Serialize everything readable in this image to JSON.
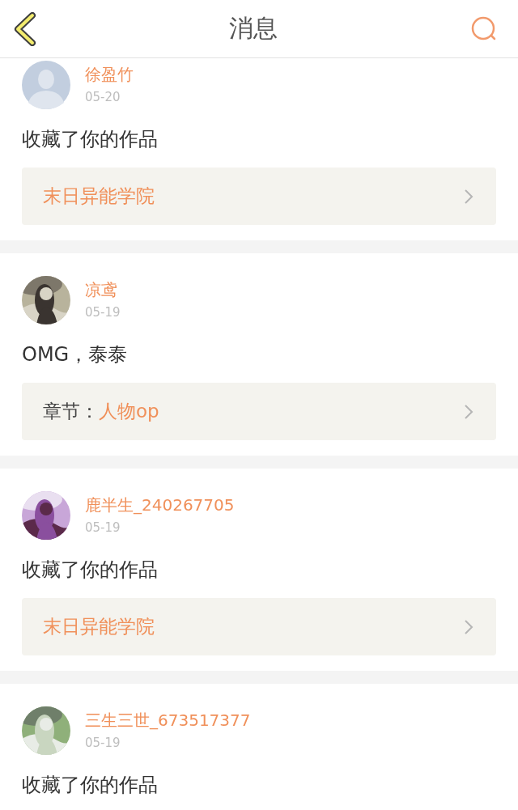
{
  "header": {
    "title": "消息"
  },
  "messages": [
    {
      "name": "徐盈竹",
      "date": "05-20",
      "avatar": {
        "kind": "default"
      },
      "text": "收藏了你的作品",
      "reference": [
        {
          "kind": "link",
          "text": "末日异能学院"
        }
      ]
    },
    {
      "name": "凉鸢",
      "date": "05-19",
      "avatar": {
        "kind": "picture"
      },
      "text": "OMG，泰泰",
      "reference": [
        {
          "kind": "label",
          "text": "章节："
        },
        {
          "kind": "link",
          "text": "人物op"
        }
      ]
    },
    {
      "name": "鹿半生_240267705",
      "date": "05-19",
      "avatar": {
        "kind": "picture"
      },
      "text": "收藏了你的作品",
      "reference": [
        {
          "kind": "link",
          "text": "末日异能学院"
        }
      ]
    },
    {
      "name": "三生三世_673517377",
      "date": "05-19",
      "avatar": {
        "kind": "picture"
      },
      "text": "收藏了你的作品"
    }
  ]
}
